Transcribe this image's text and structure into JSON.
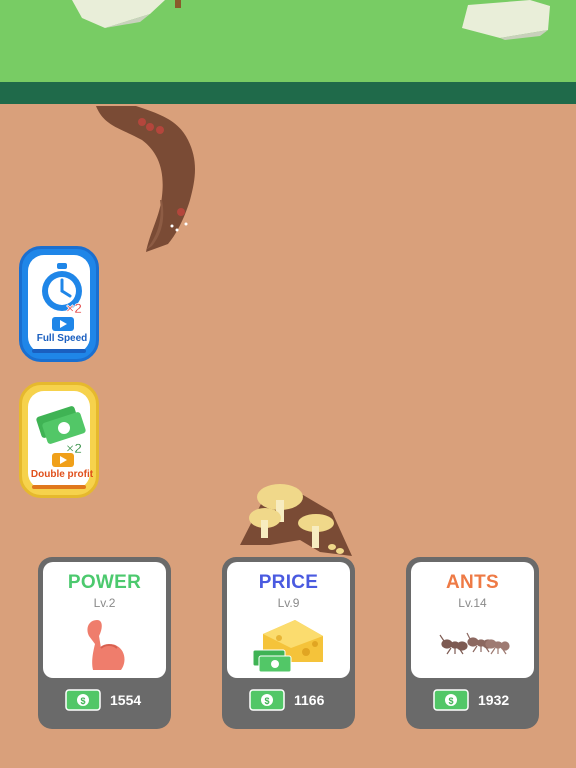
{
  "boosts": {
    "speed": {
      "label": "Full Speed",
      "multiplier": "×2",
      "icon": "stopwatch-icon"
    },
    "profit": {
      "label": "Double profit",
      "multiplier": "×2",
      "icon": "cash-stack-icon"
    }
  },
  "upgrades": [
    {
      "title": "POWER",
      "level": "Lv.2",
      "cost": "1554",
      "icon": "muscle-arm-icon",
      "color": "#4cc96e"
    },
    {
      "title": "PRICE",
      "level": "Lv.9",
      "cost": "1166",
      "icon": "cheese-cash-icon",
      "color": "#4a5ae0"
    },
    {
      "title": "ANTS",
      "level": "Lv.14",
      "cost": "1932",
      "icon": "ants-icon",
      "color": "#ee7a45"
    }
  ],
  "colors": {
    "grass": "#78cc64",
    "grass_edge": "#1f6a4a",
    "dirt": "#d9a07b",
    "tunnel": "#7a4b35",
    "card_frame": "#6a6a6a"
  }
}
